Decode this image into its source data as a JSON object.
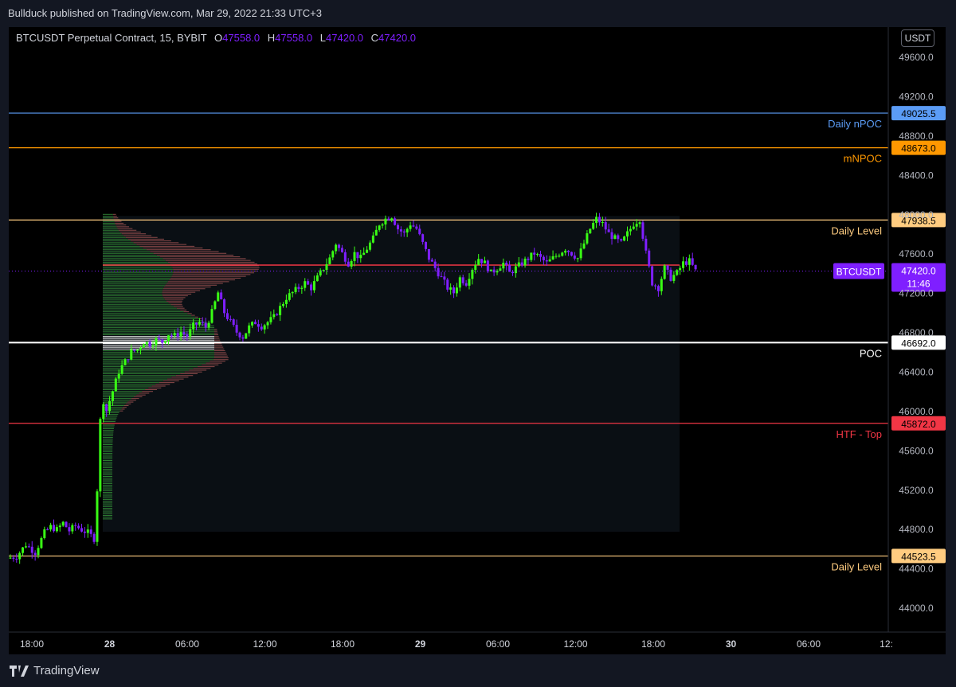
{
  "header": {
    "published": "Bullduck published on TradingView.com, Mar 29, 2022 21:33 UTC+3"
  },
  "legend": {
    "symbol": "BTCUSDT Perpetual Contract, 15, BYBIT",
    "o_label": "O",
    "o": "47558.0",
    "h_label": "H",
    "h": "47558.0",
    "l_label": "L",
    "l": "47420.0",
    "c_label": "C",
    "c": "47420.0"
  },
  "currency_button": "USDT",
  "footer": {
    "brand": "TradingView"
  },
  "colors": {
    "up": "#39ff14",
    "down": "#7f1fff",
    "bg": "#000000",
    "panel": "#131722",
    "daily_npoc": "#5b9cf6",
    "mnpoc": "#ff9800",
    "daily_level": "#ffcc80",
    "poc": "#ffffff",
    "htf_top": "#f23645",
    "price": "#7f1fff"
  },
  "chart_data": {
    "type": "candlestick",
    "y_range": [
      43750,
      49900
    ],
    "y_ticks": [
      "44000.0",
      "44400.0",
      "44800.0",
      "45200.0",
      "45600.0",
      "46000.0",
      "46400.0",
      "46800.0",
      "47200.0",
      "47600.0",
      "48000.0",
      "48400.0",
      "48800.0",
      "49200.0",
      "49600.0"
    ],
    "x_ticks": [
      "18:00",
      "28",
      "06:00",
      "12:00",
      "18:00",
      "29",
      "06:00",
      "12:00",
      "18:00",
      "30",
      "06:00",
      "12:"
    ],
    "levels": [
      {
        "label": "Daily nPOC",
        "price": "49025.5",
        "color": "#5b9cf6"
      },
      {
        "label": "mNPOC",
        "price": "48673.0",
        "color": "#ff9800"
      },
      {
        "label": "Daily Level",
        "price": "47938.5",
        "color": "#ffcc80"
      },
      {
        "label": "POC",
        "price": "46692.0",
        "color": "#ffffff"
      },
      {
        "label": "HTF - Top",
        "price": "45872.0",
        "color": "#f23645"
      },
      {
        "label": "Daily Level",
        "price": "44523.5",
        "color": "#ffcc80"
      }
    ],
    "current_price": {
      "label": "BTCUSDT",
      "price": "47420.0",
      "countdown": "11:46"
    },
    "price_path": [
      [
        0,
        44500
      ],
      [
        3,
        44520
      ],
      [
        6,
        44640
      ],
      [
        9,
        44560
      ],
      [
        12,
        44760
      ],
      [
        14,
        44820
      ],
      [
        16,
        44790
      ],
      [
        18,
        44860
      ],
      [
        20,
        44780
      ],
      [
        22,
        44830
      ],
      [
        24,
        44790
      ],
      [
        26,
        44760
      ],
      [
        28,
        44700
      ],
      [
        29,
        45200
      ],
      [
        30,
        45900
      ],
      [
        31,
        46100
      ],
      [
        32,
        46000
      ],
      [
        34,
        46200
      ],
      [
        36,
        46400
      ],
      [
        38,
        46500
      ],
      [
        40,
        46600
      ],
      [
        42,
        46620
      ],
      [
        44,
        46700
      ],
      [
        46,
        46680
      ],
      [
        48,
        46720
      ],
      [
        50,
        46700
      ],
      [
        52,
        46780
      ],
      [
        54,
        46760
      ],
      [
        56,
        46800
      ],
      [
        58,
        46760
      ],
      [
        60,
        46860
      ],
      [
        62,
        46900
      ],
      [
        64,
        46850
      ],
      [
        66,
        47000
      ],
      [
        68,
        47200
      ],
      [
        70,
        47000
      ],
      [
        72,
        46900
      ],
      [
        74,
        46800
      ],
      [
        76,
        46750
      ],
      [
        78,
        46850
      ],
      [
        80,
        46900
      ],
      [
        82,
        46860
      ],
      [
        84,
        46900
      ],
      [
        86,
        46950
      ],
      [
        88,
        47050
      ],
      [
        90,
        47150
      ],
      [
        92,
        47200
      ],
      [
        94,
        47250
      ],
      [
        96,
        47300
      ],
      [
        98,
        47250
      ],
      [
        100,
        47350
      ],
      [
        102,
        47450
      ],
      [
        104,
        47550
      ],
      [
        106,
        47700
      ],
      [
        108,
        47600
      ],
      [
        110,
        47500
      ],
      [
        112,
        47600
      ],
      [
        114,
        47550
      ],
      [
        116,
        47650
      ],
      [
        118,
        47750
      ],
      [
        120,
        47900
      ],
      [
        122,
        47950
      ],
      [
        124,
        47980
      ],
      [
        126,
        47850
      ],
      [
        128,
        47800
      ],
      [
        130,
        47900
      ],
      [
        132,
        47850
      ],
      [
        134,
        47700
      ],
      [
        136,
        47550
      ],
      [
        138,
        47450
      ],
      [
        140,
        47350
      ],
      [
        142,
        47250
      ],
      [
        144,
        47200
      ],
      [
        146,
        47350
      ],
      [
        148,
        47300
      ],
      [
        150,
        47450
      ],
      [
        152,
        47550
      ],
      [
        154,
        47500
      ],
      [
        156,
        47400
      ],
      [
        158,
        47450
      ],
      [
        160,
        47500
      ],
      [
        162,
        47400
      ],
      [
        164,
        47450
      ],
      [
        166,
        47500
      ],
      [
        168,
        47550
      ],
      [
        170,
        47600
      ],
      [
        172,
        47550
      ],
      [
        174,
        47500
      ],
      [
        176,
        47550
      ],
      [
        178,
        47600
      ],
      [
        180,
        47650
      ],
      [
        182,
        47600
      ],
      [
        184,
        47550
      ],
      [
        186,
        47700
      ],
      [
        188,
        47850
      ],
      [
        190,
        47950
      ],
      [
        192,
        47900
      ],
      [
        194,
        47800
      ],
      [
        196,
        47750
      ],
      [
        198,
        47700
      ],
      [
        200,
        47800
      ],
      [
        202,
        47900
      ],
      [
        204,
        47950
      ],
      [
        206,
        47600
      ],
      [
        208,
        47300
      ],
      [
        210,
        47250
      ],
      [
        212,
        47450
      ],
      [
        214,
        47350
      ],
      [
        216,
        47400
      ],
      [
        218,
        47500
      ],
      [
        220,
        47520
      ],
      [
        222,
        47420
      ]
    ]
  }
}
